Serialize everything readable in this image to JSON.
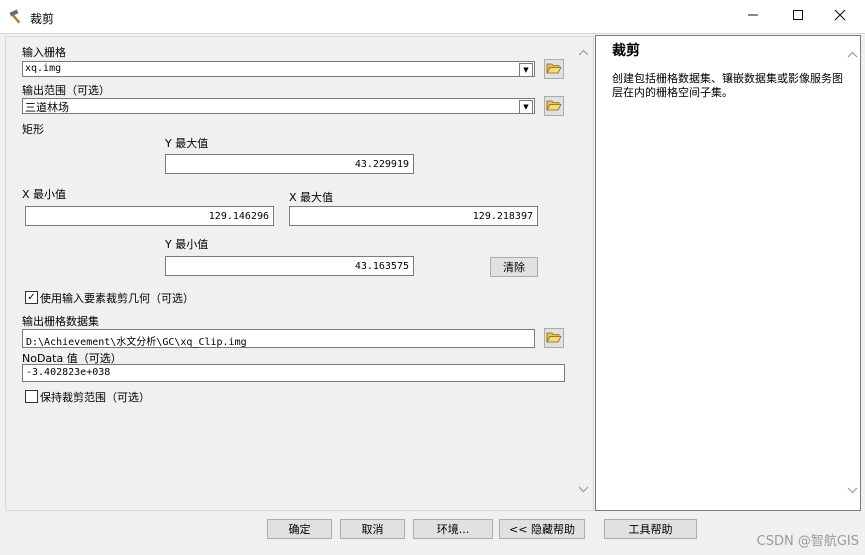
{
  "window": {
    "title": "裁剪"
  },
  "form": {
    "input_raster_label": "输入栅格",
    "input_raster_value": "xq.img",
    "output_extent_label": "输出范围（可选）",
    "output_extent_value": "三道林场",
    "rectangle_label": "矩形",
    "y_max_label": "Y 最大值",
    "y_max_value": "43.229919",
    "x_min_label": "X 最小值",
    "x_min_value": "129.146296",
    "x_max_label": "X 最大值",
    "x_max_value": "129.218397",
    "y_min_label": "Y 最小值",
    "y_min_value": "43.163575",
    "clear_button": "清除",
    "use_input_features_label": "使用输入要素裁剪几何（可选）",
    "use_input_features_checked": true,
    "output_raster_label": "输出栅格数据集",
    "output_raster_value": "D:\\Achievement\\水文分析\\GC\\xq_Clip.img",
    "nodata_label": "NoData 值（可选）",
    "nodata_value": "-3.402823e+038",
    "maintain_extent_label": "保持裁剪范围（可选）",
    "maintain_extent_checked": false
  },
  "buttons": {
    "ok": "确定",
    "cancel": "取消",
    "environments": "环境...",
    "hide_help": "<< 隐藏帮助",
    "tool_help": "工具帮助"
  },
  "help": {
    "title": "裁剪",
    "text": "创建包括栅格数据集、镶嵌数据集或影像服务图层在内的栅格空间子集。"
  },
  "watermark": "CSDN @智航GIS",
  "icons": {
    "app": "hammer-icon",
    "minimize": "minimize-icon",
    "maximize": "maximize-icon",
    "close": "close-icon",
    "folder": "folder-open-icon"
  }
}
